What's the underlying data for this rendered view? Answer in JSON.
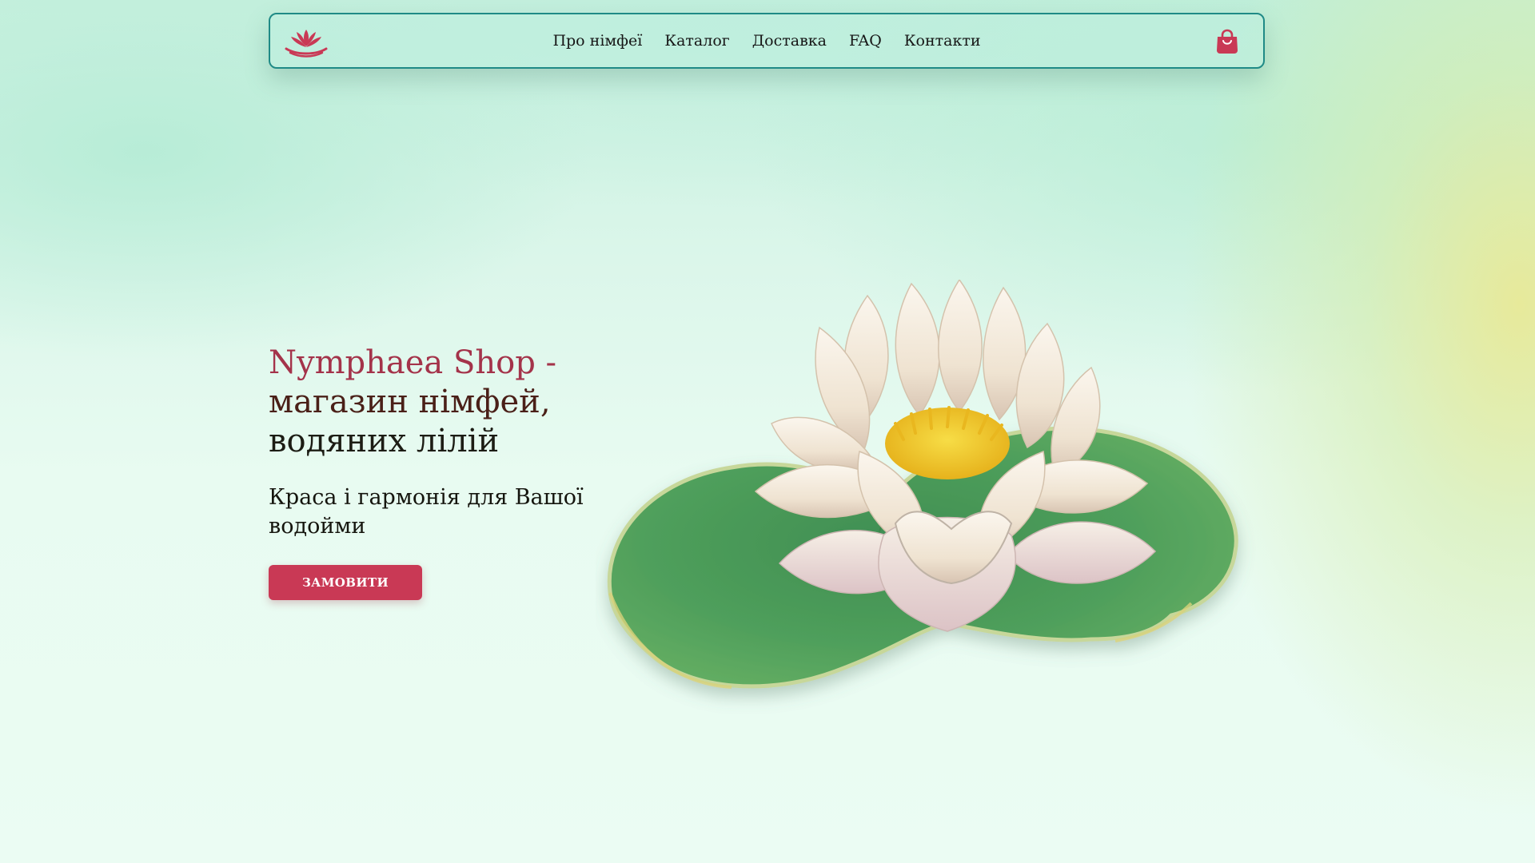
{
  "nav": {
    "logo_icon": "lotus-icon",
    "links": [
      "Про німфеї",
      "Каталог",
      "Доставка",
      "FAQ",
      "Контакти"
    ],
    "cart_icon": "shopping-bag-icon"
  },
  "hero": {
    "brand": "Nymphaea Shop -",
    "title_line2": "магазин німфей,",
    "title_line3": "водяних лілій",
    "subtitle": "Краса і гармонія для Вашої водойми",
    "cta_label": "ЗАМОВИТИ"
  },
  "colors": {
    "accent": "#c93955",
    "nav_border": "#1f8a86",
    "brand_text": "#a4334a",
    "leaf_green": "#55a45f",
    "petal": "#f1e7d7",
    "stamen": "#f5cf2a"
  },
  "illustration": {
    "icon": "water-lily-illustration"
  }
}
